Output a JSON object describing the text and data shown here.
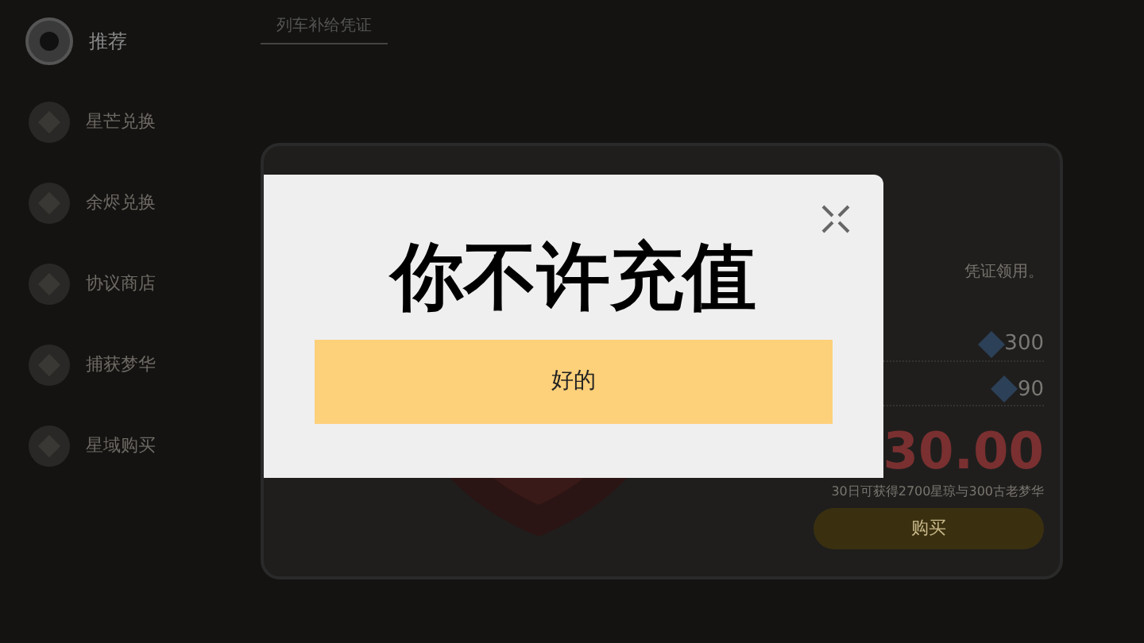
{
  "sidebar": {
    "items": [
      {
        "label": "推荐",
        "selected": true
      },
      {
        "label": "星芒兑换",
        "selected": false
      },
      {
        "label": "余烬兑换",
        "selected": false
      },
      {
        "label": "协议商店",
        "selected": false
      },
      {
        "label": "捕获梦华",
        "selected": false
      },
      {
        "label": "星域购买",
        "selected": false
      }
    ]
  },
  "tabs": [
    {
      "label": "列车补给凭证",
      "selected": true
    }
  ],
  "card": {
    "description": "凭证领用。",
    "rewards": [
      {
        "amount": "300"
      },
      {
        "amount": "90"
      }
    ],
    "price": "30.00",
    "note": "30日可获得2700星琼与300古老梦华",
    "buy_button": "购买"
  },
  "dialog": {
    "message": "你不许充值",
    "confirm_button": "好的"
  }
}
